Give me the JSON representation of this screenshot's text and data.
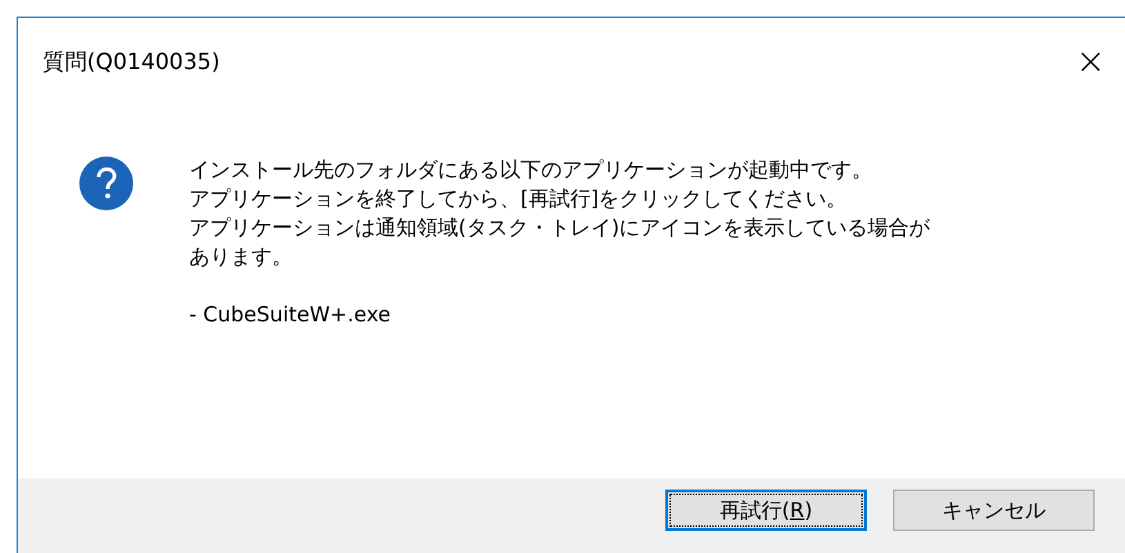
{
  "window": {
    "title": "質問(Q0140035)",
    "close": "×"
  },
  "message": {
    "lines": [
      "インストール先のフォルダにある以下のアプリケーションが起動中です。",
      "アプリケーションを終了してから、[再試行]をクリックしてください。",
      "アプリケーションは通知領域(タスク・トレイ)にアイコンを表示している場合が",
      "あります。"
    ],
    "item": "- CubeSuiteW+.exe"
  },
  "buttons": [
    {
      "label_before": "再試行(",
      "mnemonic": "R",
      "label_after": ")",
      "default": true
    },
    {
      "label_before": "キャンセル",
      "default": false
    }
  ]
}
